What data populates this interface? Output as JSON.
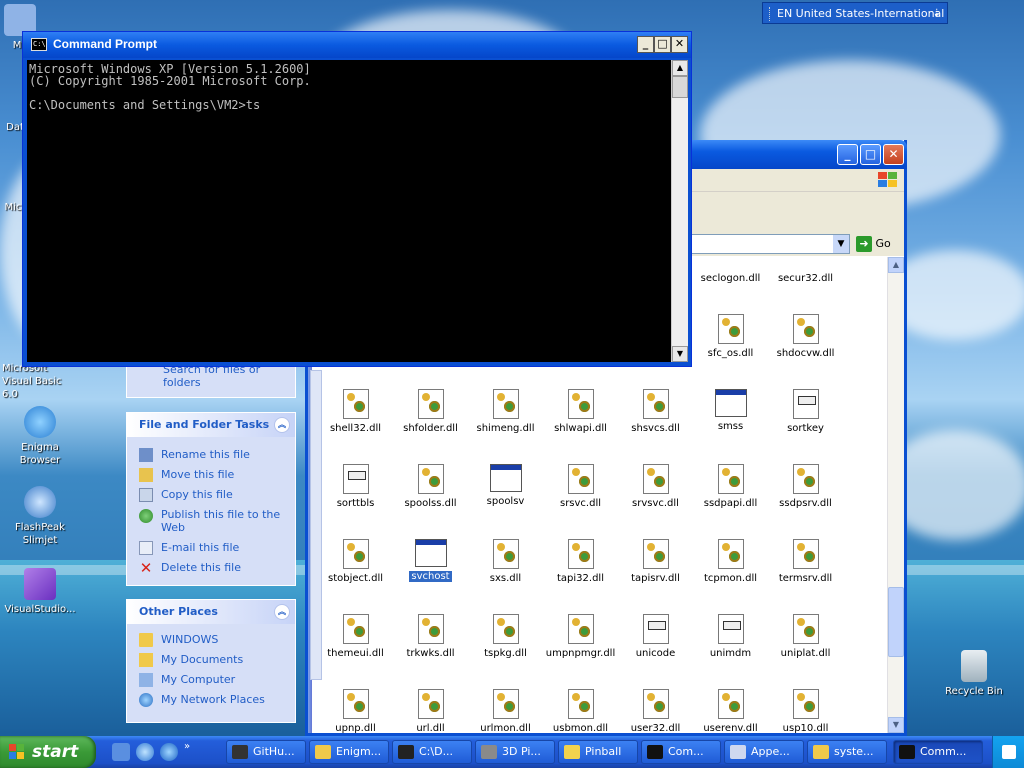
{
  "desktop": {
    "icons": [
      {
        "label": "My",
        "name": "desktop-icon-my-computer",
        "color": "#8fb3e6"
      },
      {
        "label": "Dat",
        "name": "desktop-icon-data",
        "color": "#d9b85b"
      },
      {
        "label": "Micr",
        "name": "desktop-icon-microsoft",
        "color": "#6e9dd8"
      },
      {
        "label": "Microsoft Visual Basic 6.0",
        "name": "desktop-icon-visual-basic",
        "color": "#6e9dd8"
      },
      {
        "label": "Enigma Browser",
        "name": "desktop-icon-enigma-browser",
        "color": "#3c8fd8"
      },
      {
        "label": "FlashPeak Slimjet",
        "name": "desktop-icon-slimjet",
        "color": "#4a9ad8"
      },
      {
        "label": "VisualStudio...",
        "name": "desktop-icon-visual-studio",
        "color": "#8a5bd6"
      },
      {
        "label": "Recycle Bin",
        "name": "desktop-icon-recycle-bin",
        "color": "#dfe8ef"
      }
    ]
  },
  "language_bar": {
    "label": "EN United States-International"
  },
  "cmd": {
    "title": "Command Prompt",
    "icon_text": "C:\\",
    "lines": "Microsoft Windows XP [Version 5.1.2600]\n(C) Copyright 1985-2001 Microsoft Corp.\n\nC:\\Documents and Settings\\VM2>ts",
    "minimize": "_",
    "maximize": "□",
    "close": "✕"
  },
  "explorer": {
    "go_label": "Go",
    "search_task": "Search for files or folders",
    "file_tasks": {
      "header": "File and Folder Tasks",
      "items": [
        {
          "label": "Rename this file",
          "icon": "rename-icon"
        },
        {
          "label": "Move this file",
          "icon": "move-icon"
        },
        {
          "label": "Copy this file",
          "icon": "copy-icon"
        },
        {
          "label": "Publish this file to the Web",
          "icon": "publish-icon"
        },
        {
          "label": "E-mail this file",
          "icon": "email-icon"
        },
        {
          "label": "Delete this file",
          "icon": "delete-icon"
        }
      ]
    },
    "other_places": {
      "header": "Other Places",
      "items": [
        {
          "label": "WINDOWS",
          "icon": "folder-icon"
        },
        {
          "label": "My Documents",
          "icon": "my-documents-icon"
        },
        {
          "label": "My Computer",
          "icon": "my-computer-icon"
        },
        {
          "label": "My Network Places",
          "icon": "network-places-icon"
        }
      ]
    },
    "files": [
      [
        "seclogon.dll",
        "secur32.dll"
      ],
      [
        "sfc_os.dll",
        "shdocvw.dll"
      ],
      [
        "shell32.dll",
        "shfolder.dll",
        "shimeng.dll",
        "shlwapi.dll",
        "shsvcs.dll",
        "smss",
        "sortkey"
      ],
      [
        "sorttbls",
        "spoolss.dll",
        "spoolsv",
        "srsvc.dll",
        "srvsvc.dll",
        "ssdpapi.dll",
        "ssdpsrv.dll"
      ],
      [
        "stobject.dll",
        "svchost",
        "sxs.dll",
        "tapi32.dll",
        "tapisrv.dll",
        "tcpmon.dll",
        "termsrv.dll"
      ],
      [
        "themeui.dll",
        "trkwks.dll",
        "tspkg.dll",
        "umpnpmgr.dll",
        "unicode",
        "unimdm",
        "uniplat.dll"
      ],
      [
        "upnp.dll",
        "url.dll",
        "urlmon.dll",
        "usbmon.dll",
        "user32.dll",
        "userenv.dll",
        "usp10.dll"
      ]
    ],
    "file_types": [
      [
        "dll",
        "dll"
      ],
      [
        "dll",
        "dll"
      ],
      [
        "dll",
        "dll",
        "dll",
        "dll",
        "dll",
        "exe",
        "doc"
      ],
      [
        "doc",
        "dll",
        "exe",
        "dll",
        "dll",
        "dll",
        "dll"
      ],
      [
        "dll",
        "exe",
        "dll",
        "dll",
        "dll",
        "dll",
        "dll"
      ],
      [
        "dll",
        "dll",
        "dll",
        "dll",
        "doc",
        "doc",
        "dll"
      ],
      [
        "dll",
        "dll",
        "dll",
        "dll",
        "dll",
        "dll",
        "dll"
      ]
    ],
    "selected_file": "svchost"
  },
  "taskbar": {
    "start_label": "start",
    "buttons": [
      {
        "label": "GitHu...",
        "name": "taskbar-github",
        "icon_color": "#333333"
      },
      {
        "label": "Enigm...",
        "name": "taskbar-enigma",
        "icon_color": "#f0c94a"
      },
      {
        "label": "C:\\D...",
        "name": "taskbar-7zip",
        "icon_color": "#222222"
      },
      {
        "label": "3D Pi...",
        "name": "taskbar-3d-pinball",
        "icon_color": "#8a8a8a"
      },
      {
        "label": "Pinball",
        "name": "taskbar-pinball",
        "icon_color": "#f2d34e"
      },
      {
        "label": "Com...",
        "name": "taskbar-cmd-1",
        "icon_color": "#111111"
      },
      {
        "label": "Appe...",
        "name": "taskbar-appearance",
        "icon_color": "#cfd8ef"
      },
      {
        "label": "syste...",
        "name": "taskbar-system32",
        "icon_color": "#f0c94a"
      },
      {
        "label": "Comm...",
        "name": "taskbar-cmd-2",
        "icon_color": "#111111",
        "active": true
      }
    ]
  }
}
